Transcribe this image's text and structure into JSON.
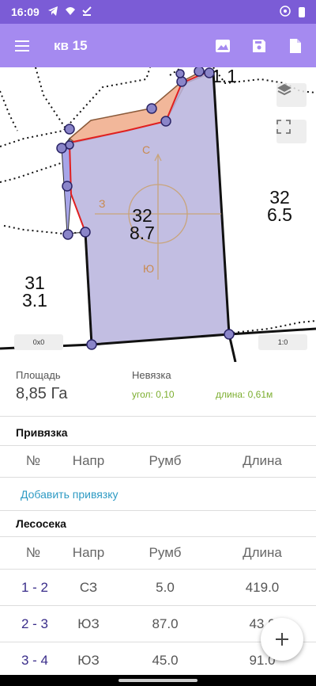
{
  "status": {
    "time": "16:09",
    "icons": [
      "telegram-icon",
      "wifi-calling-icon",
      "download-done-icon"
    ],
    "right_icons": [
      "vpn-key-icon",
      "battery-icon"
    ]
  },
  "app_bar": {
    "title": "кв 15",
    "actions": [
      "image-icon",
      "save-icon",
      "file-icon"
    ]
  },
  "map": {
    "labels": [
      {
        "line1": "1.1",
        "line2": ""
      },
      {
        "line1": "32",
        "line2": "6.5"
      },
      {
        "line1": "32",
        "line2": "8.7"
      },
      {
        "line1": "31",
        "line2": "3.1"
      }
    ],
    "compass": {
      "north": "С",
      "west": "З",
      "south": "Ю"
    },
    "scale_left": "0x0",
    "scale_right": "1:0",
    "colors": {
      "polygon_fill": "#b7b3dd",
      "polygon_stroke": "#e02020",
      "orange_fill": "#f2b79a",
      "vertex": "#8a85c9"
    }
  },
  "info": {
    "area_label": "Площадь",
    "area_value": "8,85 Га",
    "misclosure_label": "Невязка",
    "angle": "угол: 0,10",
    "length": "длина: 0,61м"
  },
  "binding": {
    "title": "Привязка",
    "headers": [
      "№",
      "Напр",
      "Румб",
      "Длина"
    ],
    "add_link": "Добавить привязку"
  },
  "plot": {
    "title": "Лесосека",
    "headers": [
      "№",
      "Напр",
      "Румб",
      "Длина"
    ],
    "rows": [
      {
        "num": "1 - 2",
        "dir": "СЗ",
        "rumb": "5.0",
        "length": "419.0"
      },
      {
        "num": "2 - 3",
        "dir": "ЮЗ",
        "rumb": "87.0",
        "length": "43.0"
      },
      {
        "num": "3 - 4",
        "dir": "ЮЗ",
        "rumb": "45.0",
        "length": "91.0"
      }
    ]
  },
  "fab": {
    "icon": "plus-icon"
  }
}
